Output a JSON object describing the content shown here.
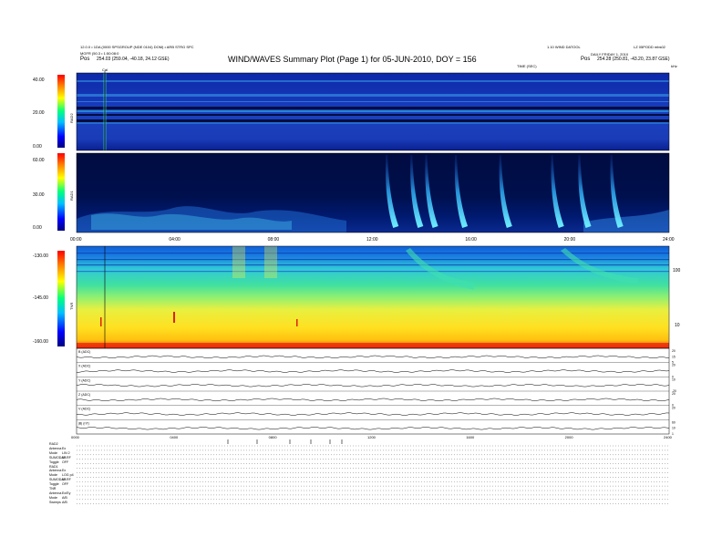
{
  "header": {
    "left_lines": [
      "12.0.0 • 1DA (0000 SPSGROUP (NDE 0104) DOM) • ARB STRG SPC",
      "MGFR (50.3 • 1:50:08:0"
    ],
    "left_pos_label": "Pos",
    "left_pos_value": "254.03 (259.04, -40.18, 24.12 GSE)",
    "right_lines": [
      "1.10 WIND DATOOL",
      "DAILY FRIDAY 1, 2010"
    ],
    "right_code": "LZ 05PODD mbs02",
    "right_pos_label": "Pos",
    "right_pos_value": "254.28 (250.81, -43.20, 23.87 GSE)",
    "title": "WIND/WAVES Summary Plot (Page 1) for 05-JUN-2010, DOY = 156",
    "top_axis_label": "TIME (SEC)",
    "khz_label": "kHz",
    "cal_marker": "Cal"
  },
  "chart_data": [
    {
      "type": "heatmap",
      "panel": "RAD2",
      "ylabel": "RAD2",
      "y_ticks": [
        "40.00",
        "20.00",
        "0.00"
      ],
      "ylim": [
        0,
        40
      ],
      "xlim": [
        0,
        24
      ]
    },
    {
      "type": "heatmap",
      "panel": "RAD1",
      "ylabel": "RAD1",
      "y_ticks": [
        "60.00",
        "30.00",
        "0.00"
      ],
      "ylim": [
        0,
        60
      ],
      "xlim": [
        0,
        24
      ],
      "x_ticks": [
        "00:00",
        "04:00",
        "08:00",
        "12:00",
        "16:00",
        "20:00",
        "24:00"
      ],
      "x_tick_values": [
        0,
        4,
        8,
        12,
        16,
        20,
        24
      ],
      "type3_bursts_hours": [
        12.6,
        13.6,
        14.2,
        15.4,
        17.2,
        19.3,
        20.4,
        21.7
      ]
    },
    {
      "type": "heatmap",
      "panel": "TNR",
      "ylabel": "TNR",
      "y_ticks": [
        "-130.00",
        "-145.00",
        "-160.00"
      ],
      "ylim": [
        -160,
        -130
      ],
      "right_ticks": [
        "100",
        "10"
      ],
      "xlim": [
        0,
        24
      ]
    },
    {
      "type": "line",
      "panel": "magnetometer",
      "rows": [
        {
          "label": "B (ADC)",
          "right_ticks": [
            "20",
            "15",
            "5"
          ]
        },
        {
          "label": "X (ADC)",
          "right_ticks": [
            "20",
            "0"
          ]
        },
        {
          "label": "Y (ADC)",
          "right_ticks": [
            "10",
            "-20"
          ]
        },
        {
          "label": "Z (ADC)",
          "right_ticks": [
            "20",
            "0"
          ]
        },
        {
          "label": "V (ADC)",
          "right_ticks": [
            "20"
          ]
        },
        {
          "label": "|B| (nT)",
          "right_ticks": [
            "60",
            "10",
            "1"
          ]
        }
      ],
      "x_ticks": [
        "0000",
        "0400",
        "0800",
        "1200",
        "1600",
        "2000",
        "2400"
      ],
      "x_tick_values": [
        0,
        4,
        8,
        12,
        16,
        20,
        24
      ],
      "xlim": [
        0,
        24
      ]
    }
  ],
  "status_block": {
    "rows": [
      {
        "label": "RAD2",
        "value": ""
      },
      {
        "label": "Antenna",
        "value": "Ex"
      },
      {
        "label": "Mode",
        "value": "LIN 2"
      },
      {
        "label": "SUMODAP",
        "value": "ILLRF"
      },
      {
        "label": "Toggle",
        "value": "OFF"
      },
      {
        "label": "RAD1",
        "value": ""
      },
      {
        "label": "Antenna",
        "value": "Ex"
      },
      {
        "label": "Mode",
        "value": "LOG p4"
      },
      {
        "label": "SUMODAP",
        "value": "ILLRF"
      },
      {
        "label": "Toggle",
        "value": "OFF"
      },
      {
        "label": "TNR",
        "value": ""
      },
      {
        "label": "Antenna",
        "value": "Ex/Ey"
      },
      {
        "label": "Mode",
        "value": "A/B"
      },
      {
        "label": "Sweeps",
        "value": "A/B"
      }
    ]
  },
  "colors": {
    "background": "#ffffff",
    "spectrogram_low": "#0a1f9a",
    "spectrogram_high": "#e0201a",
    "frame": "#000000"
  }
}
